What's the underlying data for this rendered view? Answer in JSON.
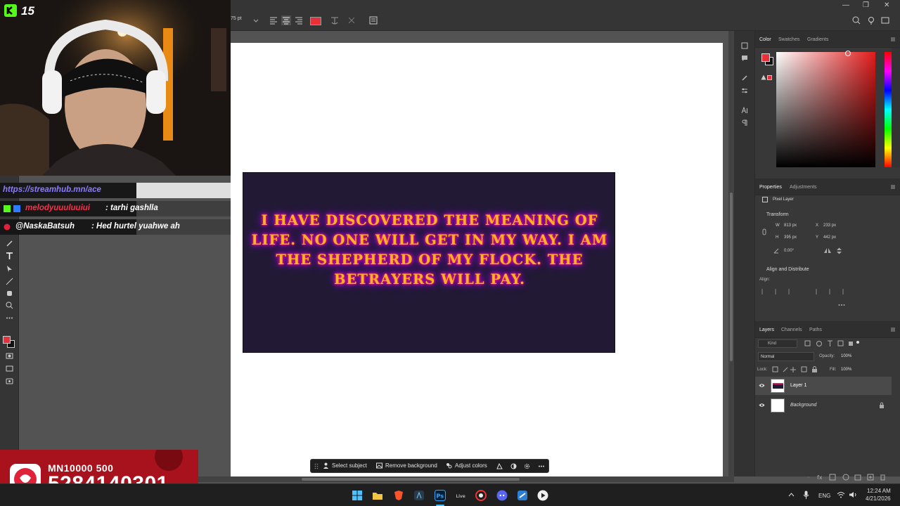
{
  "options_bar": {
    "font_size_value": "75 pt",
    "text_color": "#e8303a"
  },
  "window": {
    "minimize": "—",
    "restore": "❐",
    "close": "✕"
  },
  "canvas": {
    "artwork_text": "I HAVE DISCOVERED THE MEANING OF LIFE. NO ONE WILL GET IN MY WAY. I AM THE SHEPHERD OF MY FLOCK. THE BETRAYERS WILL PAY.",
    "artwork_bg": "#221a35"
  },
  "contextual_bar": {
    "select_subject": "Select subject",
    "remove_background": "Remove background",
    "adjust_colors": "Adjust colors"
  },
  "color_panel": {
    "tabs": [
      "Color",
      "Swatches",
      "Gradients"
    ],
    "foreground": "#e8303a",
    "background": "#111111"
  },
  "properties_panel": {
    "tabs": [
      "Properties",
      "Adjustments"
    ],
    "layer_type": "Pixel Layer",
    "transform_title": "Transform",
    "w_label": "W",
    "w_value": "813 px",
    "h_label": "H",
    "h_value": "395 px",
    "x_label": "X",
    "x_value": "233 px",
    "y_label": "Y",
    "y_value": "442 px",
    "angle_value": "0.00°",
    "align_title": "Align and Distribute",
    "align_label": "Align:"
  },
  "layers_panel": {
    "tabs": [
      "Layers",
      "Channels",
      "Paths"
    ],
    "filter_kind": "Kind",
    "blend_mode": "Normal",
    "opacity_label": "Opacity:",
    "opacity_value": "100%",
    "lock_label": "Lock:",
    "fill_label": "Fill:",
    "fill_value": "100%",
    "layers": [
      {
        "name": "Layer 1",
        "selected": true
      },
      {
        "name": "Background",
        "selected": false
      }
    ]
  },
  "stream_overlay": {
    "badge_number": "15",
    "chat": [
      {
        "user": "https://streamhub.mn/ace",
        "message": ""
      },
      {
        "user": "melodyuuuluuiui",
        "message": ": tarhi gashlla"
      },
      {
        "user": "@NaskaBatsuh",
        "message": ": Hed hurtel yuahwe ah"
      }
    ],
    "donation_line1": "MN10000 500",
    "donation_line2": "5284140301"
  },
  "taskbar": {
    "language": "ENG",
    "time": "12:24 AM",
    "date": "4/21/2026"
  }
}
